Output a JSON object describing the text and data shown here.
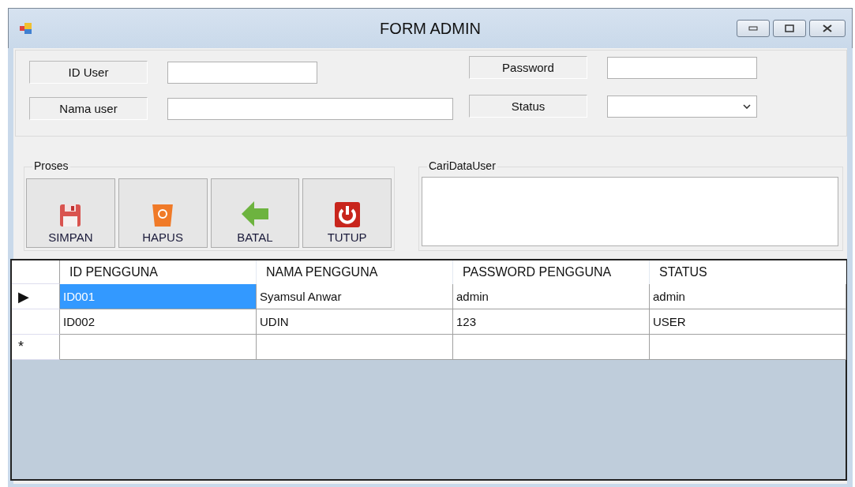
{
  "window": {
    "title": "FORM ADMIN"
  },
  "fields": {
    "id_user": {
      "label": "ID User"
    },
    "nama_user": {
      "label": "Nama user"
    },
    "password": {
      "label": "Password"
    },
    "status": {
      "label": "Status"
    }
  },
  "proses": {
    "title": "Proses",
    "buttons": [
      {
        "label": "SIMPAN",
        "kind": "save"
      },
      {
        "label": "HAPUS",
        "kind": "delete"
      },
      {
        "label": "BATAL",
        "kind": "back"
      },
      {
        "label": "TUTUP",
        "kind": "power"
      }
    ]
  },
  "search": {
    "title": "CariDataUser"
  },
  "table": {
    "columns": [
      "ID PENGGUNA",
      "NAMA PENGGUNA",
      "PASSWORD PENGGUNA",
      "STATUS"
    ],
    "rows": [
      {
        "indicator": "▶",
        "cells": [
          {
            "text": "ID001",
            "selected": true
          },
          {
            "text": "Syamsul Anwar",
            "selected": false
          },
          {
            "text": "admin",
            "selected": false
          },
          {
            "text": "admin",
            "selected": false
          }
        ]
      },
      {
        "indicator": "",
        "cells": [
          {
            "text": "ID002",
            "selected": false
          },
          {
            "text": "UDIN",
            "selected": false
          },
          {
            "text": "123",
            "selected": false
          },
          {
            "text": "USER",
            "selected": false
          }
        ]
      },
      {
        "indicator": "*",
        "cells": [
          {
            "text": "",
            "selected": false
          },
          {
            "text": "",
            "selected": false
          },
          {
            "text": "",
            "selected": false
          },
          {
            "text": "",
            "selected": false
          }
        ]
      }
    ]
  }
}
